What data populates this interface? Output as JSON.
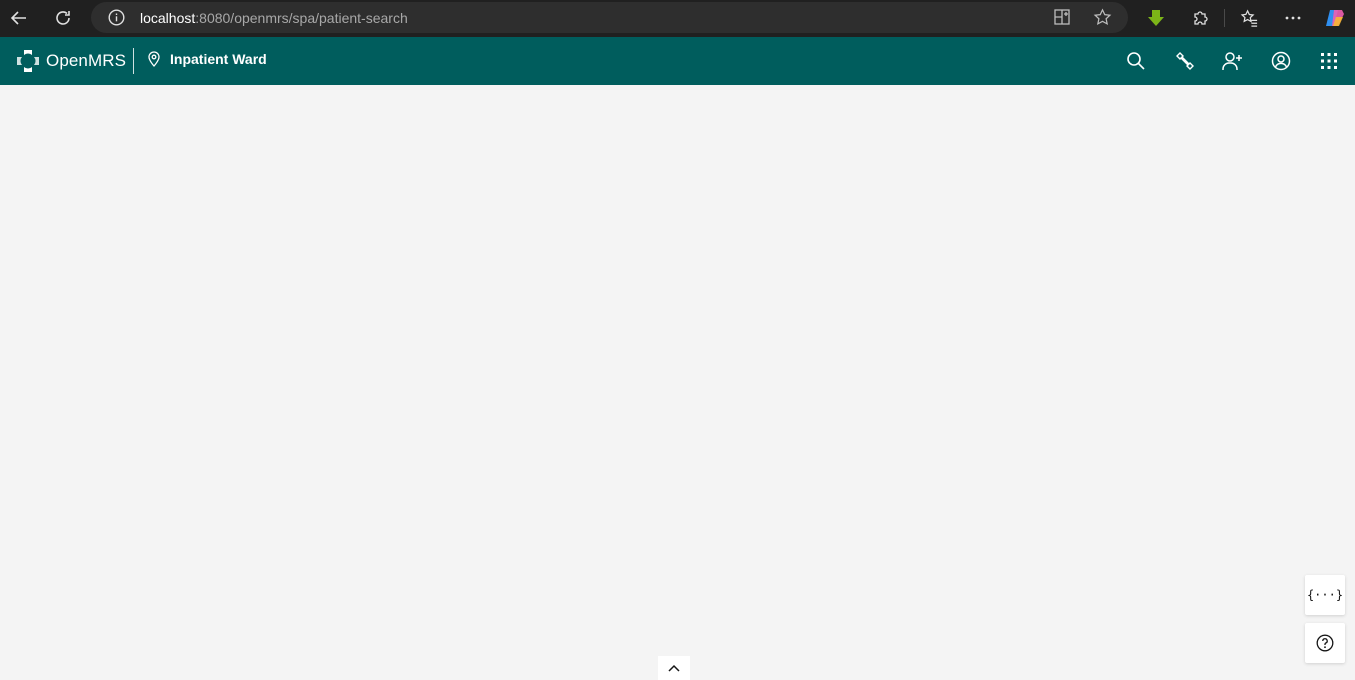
{
  "browser": {
    "url_host": "localhost",
    "url_path": ":8080/openmrs/spa/patient-search"
  },
  "app": {
    "brand": "OpenMRS",
    "location": "Inpatient Ward",
    "header_color": "#005d5d"
  },
  "header_icons": [
    "search-icon",
    "wrench-icon",
    "add-user-icon",
    "user-avatar-icon",
    "app-switcher-icon"
  ],
  "floating": {
    "devtools_label": "{···}"
  }
}
